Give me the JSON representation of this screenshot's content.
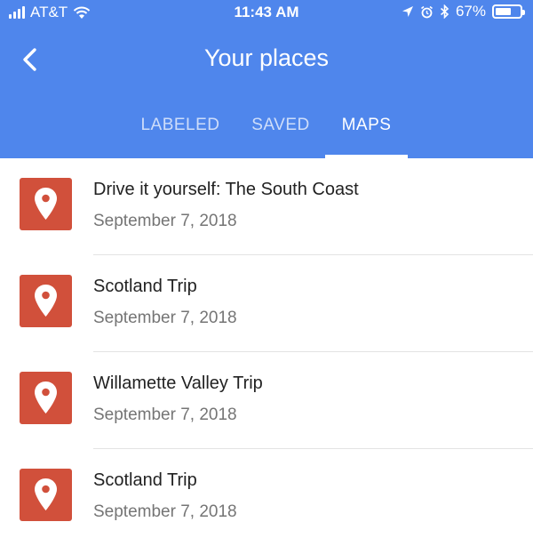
{
  "status_bar": {
    "carrier": "AT&T",
    "time": "11:43 AM",
    "battery_percent": "67%",
    "battery_level": 0.67,
    "icons": [
      "signal-icon",
      "wifi-icon",
      "location-arrow-icon",
      "alarm-icon",
      "bluetooth-icon",
      "battery-icon"
    ]
  },
  "header": {
    "title": "Your places",
    "back_icon": "chevron-left-icon",
    "background_color": "#4f86ec"
  },
  "tabs": [
    {
      "label": "LABELED",
      "active": false
    },
    {
      "label": "SAVED",
      "active": false
    },
    {
      "label": "MAPS",
      "active": true
    }
  ],
  "maps": [
    {
      "name": "Drive it yourself: The South Coast",
      "date": "September 7, 2018",
      "icon": "map-pin-icon"
    },
    {
      "name": "Scotland Trip",
      "date": "September 7, 2018",
      "icon": "map-pin-icon"
    },
    {
      "name": "Willamette Valley Trip",
      "date": "September 7, 2018",
      "icon": "map-pin-icon"
    },
    {
      "name": "Scotland Trip",
      "date": "September 7, 2018",
      "icon": "map-pin-icon"
    }
  ],
  "colors": {
    "pin_background": "#d1503b",
    "accent": "#4f86ec"
  }
}
